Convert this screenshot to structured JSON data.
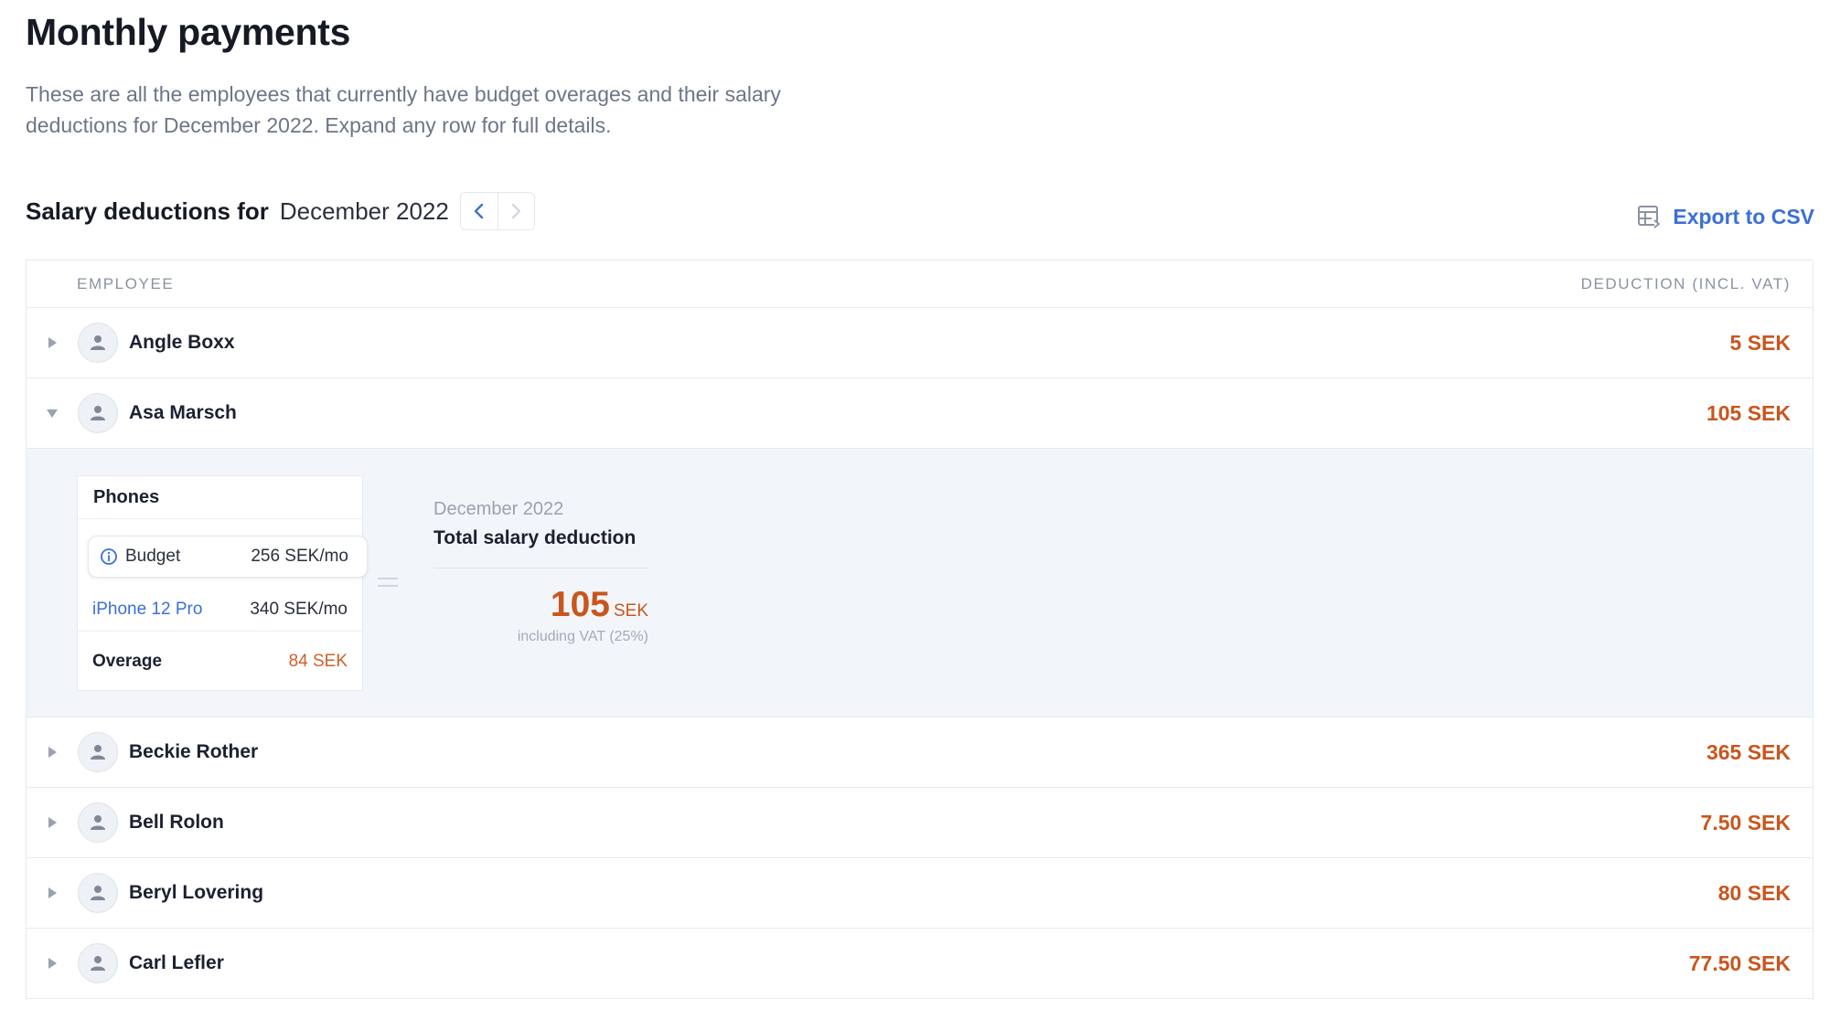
{
  "page": {
    "title": "Monthly payments",
    "intro": "These are all the employees that currently have budget overages and their salary deductions for December 2022. Expand any row for full details."
  },
  "section": {
    "label": "Salary deductions for",
    "period": "December 2022",
    "export_label": "Export to CSV"
  },
  "table": {
    "col_employee": "EMPLOYEE",
    "col_deduction": "DEDUCTION (INCL. VAT)",
    "rows": [
      {
        "name": "Angle Boxx",
        "amount": "5 SEK",
        "expanded": false
      },
      {
        "name": "Asa Marsch",
        "amount": "105 SEK",
        "expanded": true
      },
      {
        "name": "Beckie Rother",
        "amount": "365 SEK",
        "expanded": false
      },
      {
        "name": "Bell Rolon",
        "amount": "7.50 SEK",
        "expanded": false
      },
      {
        "name": "Beryl Lovering",
        "amount": "80 SEK",
        "expanded": false
      },
      {
        "name": "Carl Lefler",
        "amount": "77.50 SEK",
        "expanded": false
      }
    ]
  },
  "detail": {
    "category": "Phones",
    "budget_label": "Budget",
    "budget_value": "256 SEK/mo",
    "device_name": "iPhone 12 Pro",
    "device_price": "340 SEK/mo",
    "overage_label": "Overage",
    "overage_value": "84 SEK",
    "summary_period": "December 2022",
    "summary_title": "Total salary deduction",
    "summary_amount": "105",
    "summary_currency": "SEK",
    "summary_vat_note": "including VAT (25%)"
  },
  "icons": {
    "prev": "chevron-left-icon",
    "next": "chevron-right-icon",
    "export": "table-export-icon",
    "expand": "caret-right-icon",
    "collapse": "caret-down-icon",
    "avatar": "user-icon",
    "info": "info-icon"
  },
  "colors": {
    "accent": "#3b6fd9",
    "deduction": "#c8561d",
    "detail_background": "#f2f6fa"
  }
}
